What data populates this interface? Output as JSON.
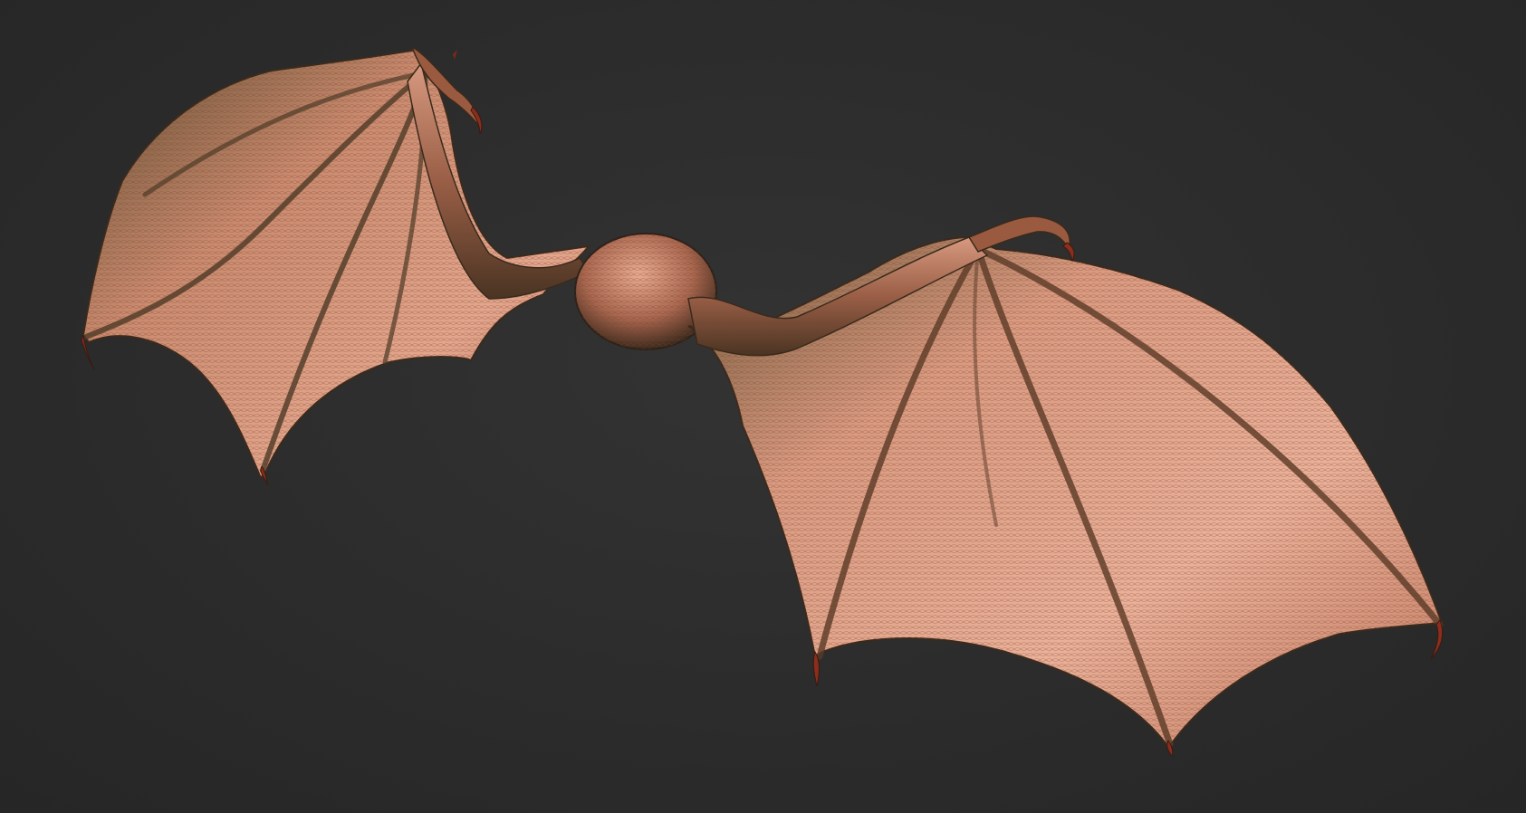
{
  "scene": {
    "subject": "sculpted-wing-model",
    "background_color": "#2b2b2b",
    "material_colors": {
      "membrane_light": "#e6a48c",
      "membrane_mid": "#c97a62",
      "membrane_dark": "#6e3a2a",
      "bone_shadow": "#3a2a1c",
      "claw_red": "#8a2e1e",
      "rim_green": "#4a4a2c"
    },
    "parts": [
      "left-wing",
      "right-wing",
      "center-shoulder-ball",
      "left-wing-claws",
      "right-wing-claws"
    ]
  }
}
